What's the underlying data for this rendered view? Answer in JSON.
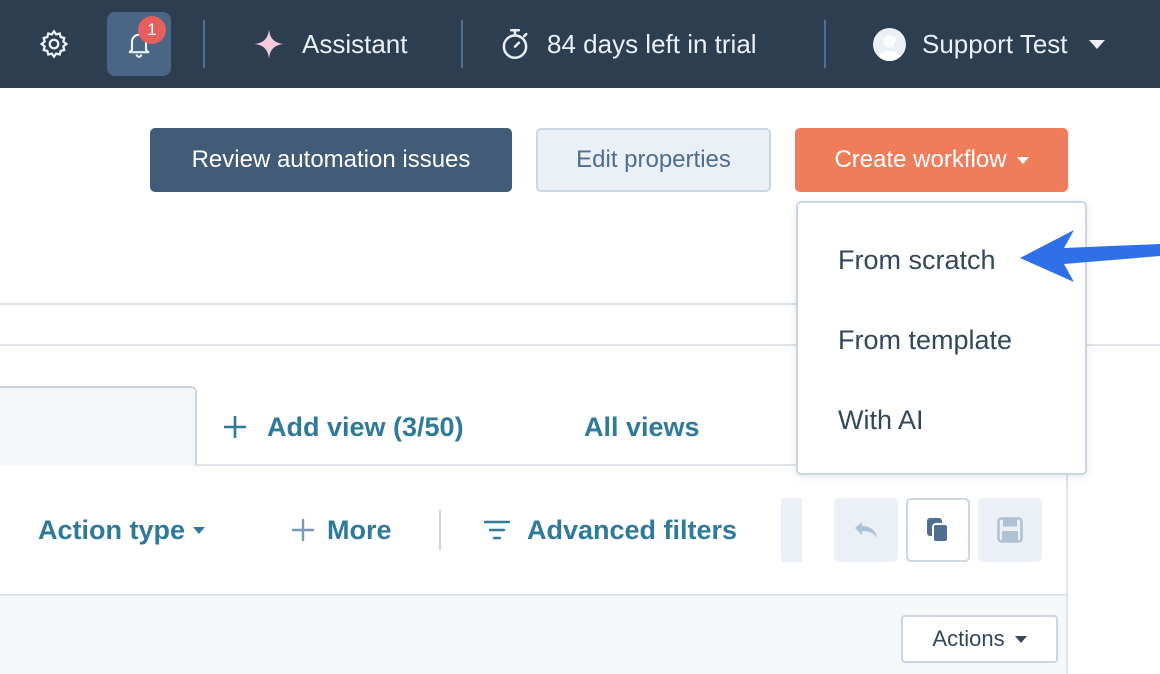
{
  "topbar": {
    "notification_count": "1",
    "assistant_label": "Assistant",
    "trial_label": "84 days left in trial",
    "user_name": "Support Test"
  },
  "header_buttons": {
    "review": "Review automation issues",
    "edit": "Edit properties",
    "create": "Create workflow"
  },
  "create_menu": {
    "items": [
      "From scratch",
      "From template",
      "With AI"
    ]
  },
  "views": {
    "add_view": "Add view (3/50)",
    "all_views": "All views"
  },
  "filters": {
    "action_type": "Action type",
    "more": "More",
    "advanced": "Advanced filters"
  },
  "table": {
    "actions_label": "Actions"
  },
  "colors": {
    "topbar": "#2d3e50",
    "primary_dark": "#425b76",
    "accent_orange": "#ef7d5b",
    "link_teal": "#2e7a98",
    "annotation_arrow": "#2f6fe8"
  }
}
